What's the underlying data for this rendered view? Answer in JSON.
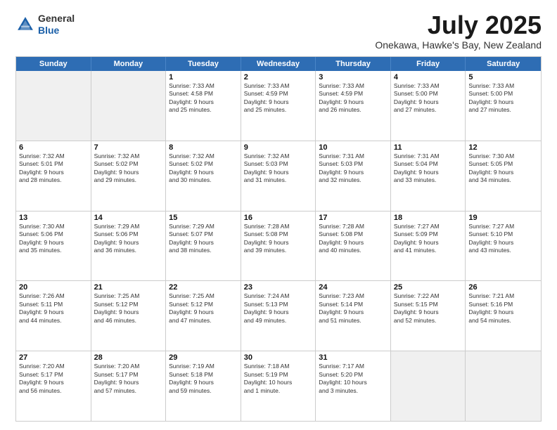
{
  "logo": {
    "general": "General",
    "blue": "Blue"
  },
  "header": {
    "month": "July 2025",
    "location": "Onekawa, Hawke's Bay, New Zealand"
  },
  "weekdays": [
    "Sunday",
    "Monday",
    "Tuesday",
    "Wednesday",
    "Thursday",
    "Friday",
    "Saturday"
  ],
  "weeks": [
    [
      {
        "day": "",
        "info": ""
      },
      {
        "day": "",
        "info": ""
      },
      {
        "day": "1",
        "info": "Sunrise: 7:33 AM\nSunset: 4:58 PM\nDaylight: 9 hours\nand 25 minutes."
      },
      {
        "day": "2",
        "info": "Sunrise: 7:33 AM\nSunset: 4:59 PM\nDaylight: 9 hours\nand 25 minutes."
      },
      {
        "day": "3",
        "info": "Sunrise: 7:33 AM\nSunset: 4:59 PM\nDaylight: 9 hours\nand 26 minutes."
      },
      {
        "day": "4",
        "info": "Sunrise: 7:33 AM\nSunset: 5:00 PM\nDaylight: 9 hours\nand 27 minutes."
      },
      {
        "day": "5",
        "info": "Sunrise: 7:33 AM\nSunset: 5:00 PM\nDaylight: 9 hours\nand 27 minutes."
      }
    ],
    [
      {
        "day": "6",
        "info": "Sunrise: 7:32 AM\nSunset: 5:01 PM\nDaylight: 9 hours\nand 28 minutes."
      },
      {
        "day": "7",
        "info": "Sunrise: 7:32 AM\nSunset: 5:02 PM\nDaylight: 9 hours\nand 29 minutes."
      },
      {
        "day": "8",
        "info": "Sunrise: 7:32 AM\nSunset: 5:02 PM\nDaylight: 9 hours\nand 30 minutes."
      },
      {
        "day": "9",
        "info": "Sunrise: 7:32 AM\nSunset: 5:03 PM\nDaylight: 9 hours\nand 31 minutes."
      },
      {
        "day": "10",
        "info": "Sunrise: 7:31 AM\nSunset: 5:03 PM\nDaylight: 9 hours\nand 32 minutes."
      },
      {
        "day": "11",
        "info": "Sunrise: 7:31 AM\nSunset: 5:04 PM\nDaylight: 9 hours\nand 33 minutes."
      },
      {
        "day": "12",
        "info": "Sunrise: 7:30 AM\nSunset: 5:05 PM\nDaylight: 9 hours\nand 34 minutes."
      }
    ],
    [
      {
        "day": "13",
        "info": "Sunrise: 7:30 AM\nSunset: 5:06 PM\nDaylight: 9 hours\nand 35 minutes."
      },
      {
        "day": "14",
        "info": "Sunrise: 7:29 AM\nSunset: 5:06 PM\nDaylight: 9 hours\nand 36 minutes."
      },
      {
        "day": "15",
        "info": "Sunrise: 7:29 AM\nSunset: 5:07 PM\nDaylight: 9 hours\nand 38 minutes."
      },
      {
        "day": "16",
        "info": "Sunrise: 7:28 AM\nSunset: 5:08 PM\nDaylight: 9 hours\nand 39 minutes."
      },
      {
        "day": "17",
        "info": "Sunrise: 7:28 AM\nSunset: 5:08 PM\nDaylight: 9 hours\nand 40 minutes."
      },
      {
        "day": "18",
        "info": "Sunrise: 7:27 AM\nSunset: 5:09 PM\nDaylight: 9 hours\nand 41 minutes."
      },
      {
        "day": "19",
        "info": "Sunrise: 7:27 AM\nSunset: 5:10 PM\nDaylight: 9 hours\nand 43 minutes."
      }
    ],
    [
      {
        "day": "20",
        "info": "Sunrise: 7:26 AM\nSunset: 5:11 PM\nDaylight: 9 hours\nand 44 minutes."
      },
      {
        "day": "21",
        "info": "Sunrise: 7:25 AM\nSunset: 5:12 PM\nDaylight: 9 hours\nand 46 minutes."
      },
      {
        "day": "22",
        "info": "Sunrise: 7:25 AM\nSunset: 5:12 PM\nDaylight: 9 hours\nand 47 minutes."
      },
      {
        "day": "23",
        "info": "Sunrise: 7:24 AM\nSunset: 5:13 PM\nDaylight: 9 hours\nand 49 minutes."
      },
      {
        "day": "24",
        "info": "Sunrise: 7:23 AM\nSunset: 5:14 PM\nDaylight: 9 hours\nand 51 minutes."
      },
      {
        "day": "25",
        "info": "Sunrise: 7:22 AM\nSunset: 5:15 PM\nDaylight: 9 hours\nand 52 minutes."
      },
      {
        "day": "26",
        "info": "Sunrise: 7:21 AM\nSunset: 5:16 PM\nDaylight: 9 hours\nand 54 minutes."
      }
    ],
    [
      {
        "day": "27",
        "info": "Sunrise: 7:20 AM\nSunset: 5:17 PM\nDaylight: 9 hours\nand 56 minutes."
      },
      {
        "day": "28",
        "info": "Sunrise: 7:20 AM\nSunset: 5:17 PM\nDaylight: 9 hours\nand 57 minutes."
      },
      {
        "day": "29",
        "info": "Sunrise: 7:19 AM\nSunset: 5:18 PM\nDaylight: 9 hours\nand 59 minutes."
      },
      {
        "day": "30",
        "info": "Sunrise: 7:18 AM\nSunset: 5:19 PM\nDaylight: 10 hours\nand 1 minute."
      },
      {
        "day": "31",
        "info": "Sunrise: 7:17 AM\nSunset: 5:20 PM\nDaylight: 10 hours\nand 3 minutes."
      },
      {
        "day": "",
        "info": ""
      },
      {
        "day": "",
        "info": ""
      }
    ]
  ]
}
